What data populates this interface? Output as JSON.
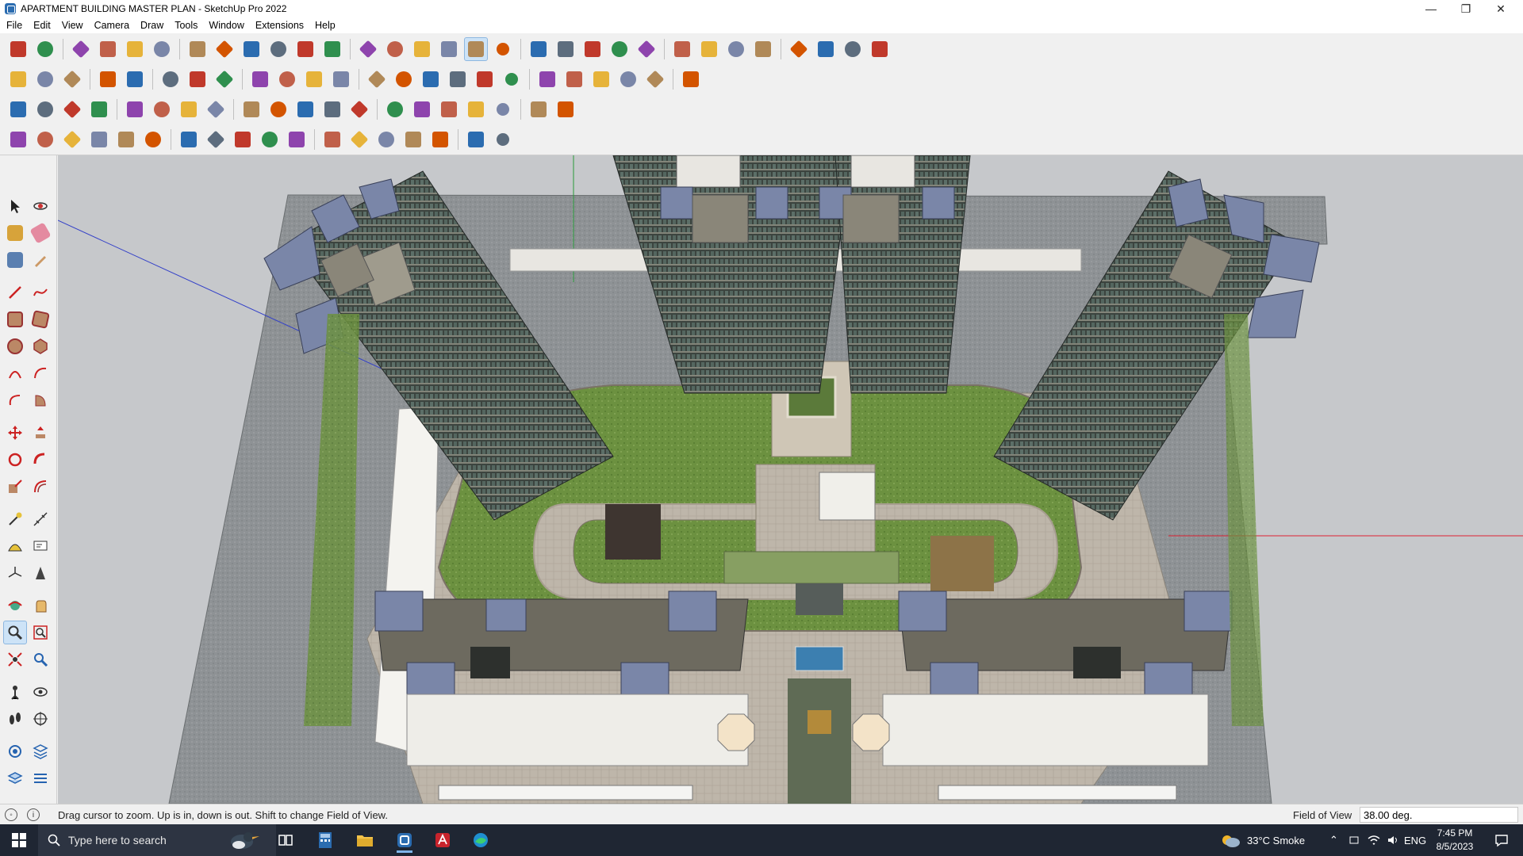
{
  "window": {
    "title": "APARTMENT BUILDING MASTER PLAN - SketchUp Pro 2022",
    "minimize_glyph": "—",
    "restore_glyph": "❐",
    "close_glyph": "✕"
  },
  "menu": [
    "File",
    "Edit",
    "View",
    "Camera",
    "Draw",
    "Tools",
    "Window",
    "Extensions",
    "Help"
  ],
  "toolbar": {
    "active_tool": "zoom",
    "row_icons": [
      [
        "zoom-extents-icon",
        "select-icon",
        "eraser-icon",
        "pencil-icon",
        "arc-icon",
        "rectangle-icon",
        "push-pull-icon",
        "follow-me-icon",
        "move-icon",
        "rotate-icon",
        "scale-icon",
        "tape-measure-icon",
        "text-icon",
        "paint-bucket-icon",
        "orbit-icon",
        "pan-icon",
        "zoom-icon",
        "zoom-window-icon",
        "section-plane-icon",
        "styles-icon",
        "layers-icon",
        "shadows-icon",
        "components-icon",
        "warehouse-icon",
        "extension-icon",
        "flip-icon",
        "solid-tools-icon",
        "tag-icon",
        "undo-icon",
        "redo-icon",
        "outliner-icon"
      ],
      [
        "iso-view-icon",
        "top-view-icon",
        "front-view-icon",
        "sandbox-icon",
        "stamp-icon",
        "section-cut-icon",
        "section-fill-icon",
        "curve-icon",
        "house-icon",
        "fredo-icon",
        "building-icon",
        "wall-icon",
        "roof-icon",
        "window-icon",
        "door-icon",
        "material-icon",
        "texture-icon",
        "extrude-icon",
        "bezier-icon",
        "polygon-icon",
        "circle-icon",
        "ellipse-icon",
        "line-icon",
        "tools-extra-icon"
      ],
      [
        "shape-blue-icon",
        "shape-gold-icon",
        "shape-green-icon",
        "shape-red-icon",
        "loop-icon",
        "fill-icon",
        "grid-icon",
        "door-frame-icon",
        "profile-icon",
        "joint-icon",
        "cross-icon",
        "star-icon",
        "cone-icon",
        "arc-tool-icon",
        "bend-icon",
        "weld-icon",
        "rope-icon",
        "push-icon",
        "split-icon",
        "divide-icon"
      ],
      [
        "poly-icon",
        "path-icon",
        "cut-icon",
        "slice-icon",
        "gear-icon",
        "shell-icon",
        "twist-icon",
        "box-icon",
        "sphere-icon",
        "fillet-icon",
        "chamfer-icon",
        "offset-icon",
        "stair-icon",
        "railing-icon",
        "column-icon",
        "array-icon",
        "roof-tile-icon",
        "hatch-icon"
      ]
    ]
  },
  "status": {
    "hint": "Drag cursor to zoom.  Up is in, down is out. Shift to change Field of View.",
    "vcb_label": "Field of View",
    "vcb_value": "38.00 deg."
  },
  "taskbar": {
    "search_placeholder": "Type here to search",
    "weather": "33°C  Smoke",
    "language": "ENG",
    "time": "7:45 PM",
    "date": "8/5/2023"
  },
  "colors": {
    "accent": "#cde3f7",
    "taskbar_bg": "#1f2633",
    "ground": "#c6c8cb",
    "lawn": "#6b8f3e",
    "paving": "#bfb5a8",
    "tower_dark": "#3c423e",
    "roof": "#7a86a8"
  }
}
